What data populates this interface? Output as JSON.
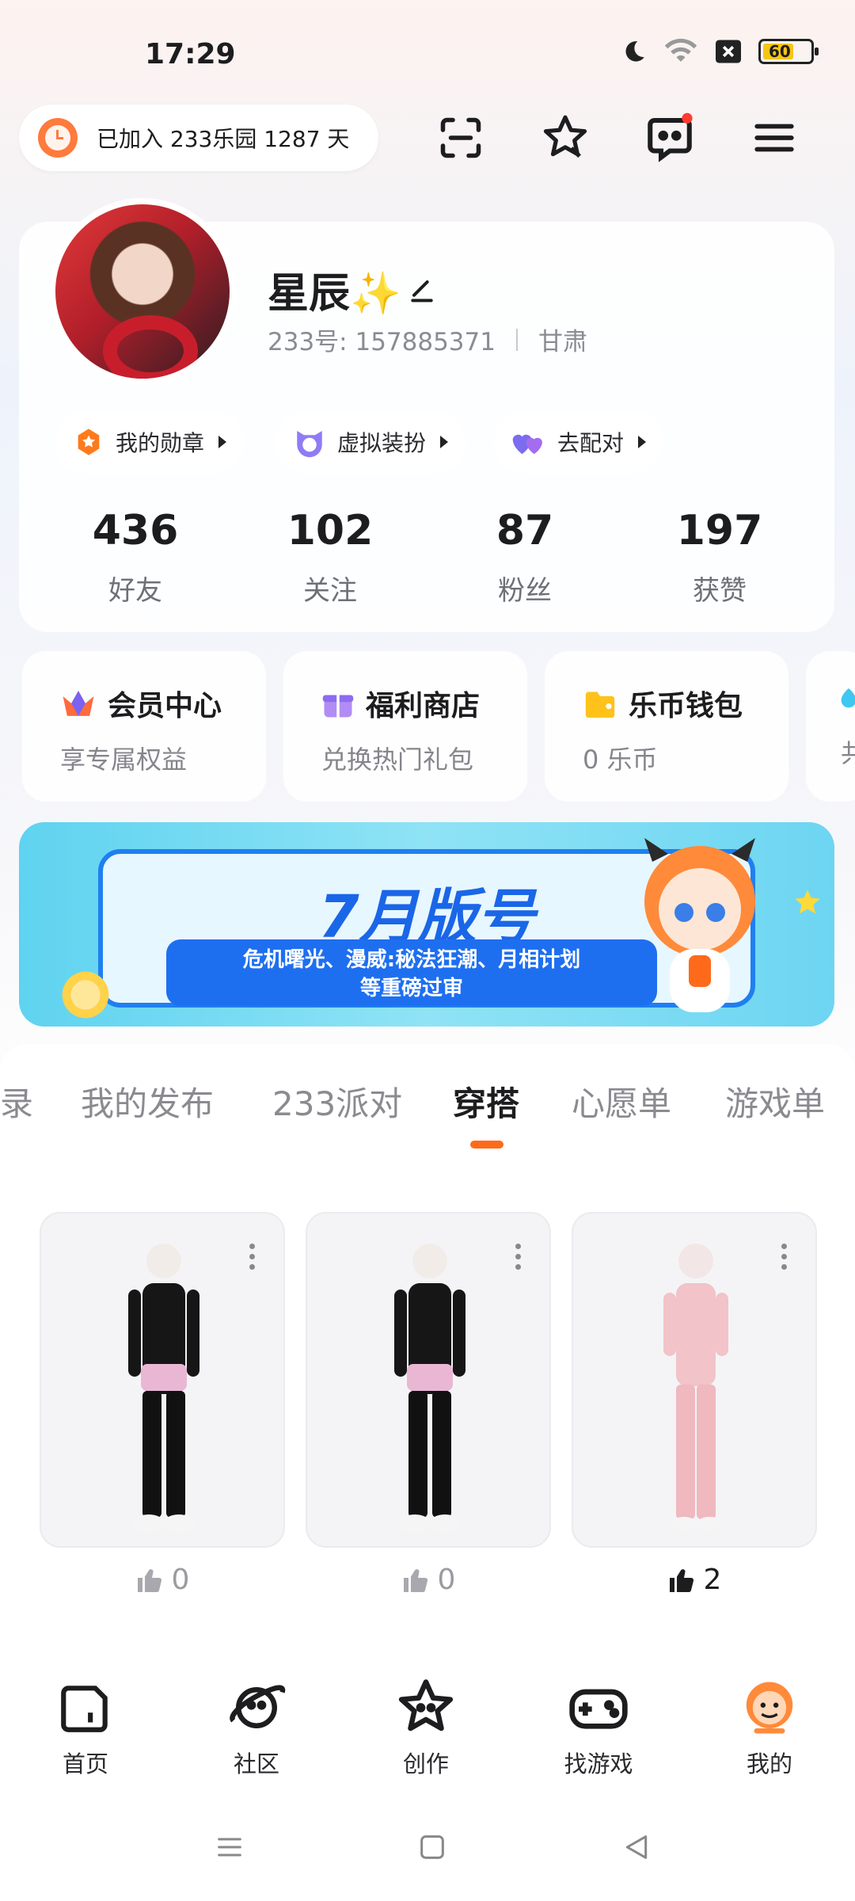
{
  "status_bar": {
    "time": "17:29",
    "battery": "60"
  },
  "header": {
    "join_text": "已加入 233乐园 1287 天"
  },
  "profile": {
    "nickname": "星辰✨",
    "id_label": "233号: 157885371",
    "region": "甘肃",
    "chips": [
      "我的勋章",
      "虚拟装扮",
      "去配对"
    ]
  },
  "stats": [
    {
      "value": "436",
      "label": "好友"
    },
    {
      "value": "102",
      "label": "关注"
    },
    {
      "value": "87",
      "label": "粉丝"
    },
    {
      "value": "197",
      "label": "获赞"
    }
  ],
  "services": [
    {
      "title": "会员中心",
      "subtitle": "享专属权益"
    },
    {
      "title": "福利商店",
      "subtitle": "兑换热门礼包"
    },
    {
      "title": "乐币钱包",
      "subtitle": "0 乐币"
    },
    {
      "title": "",
      "subtitle": "共"
    }
  ],
  "banner": {
    "title": "7月版号",
    "subtitle_line1": "危机曙光、漫威:秘法狂潮、月相计划",
    "subtitle_line2": "等重磅过审"
  },
  "tabs": [
    "录",
    "我的发布",
    "233派对",
    "穿搭",
    "心愿单",
    "游戏单"
  ],
  "active_tab": "穿搭",
  "outfits": [
    {
      "likes": "0",
      "liked": false
    },
    {
      "likes": "0",
      "liked": false
    },
    {
      "likes": "2",
      "liked": true
    }
  ],
  "bottom_nav": [
    "首页",
    "社区",
    "创作",
    "找游戏",
    "我的"
  ],
  "colors": {
    "accent": "#ff6a1a",
    "brand_blue": "#1a66e8"
  }
}
